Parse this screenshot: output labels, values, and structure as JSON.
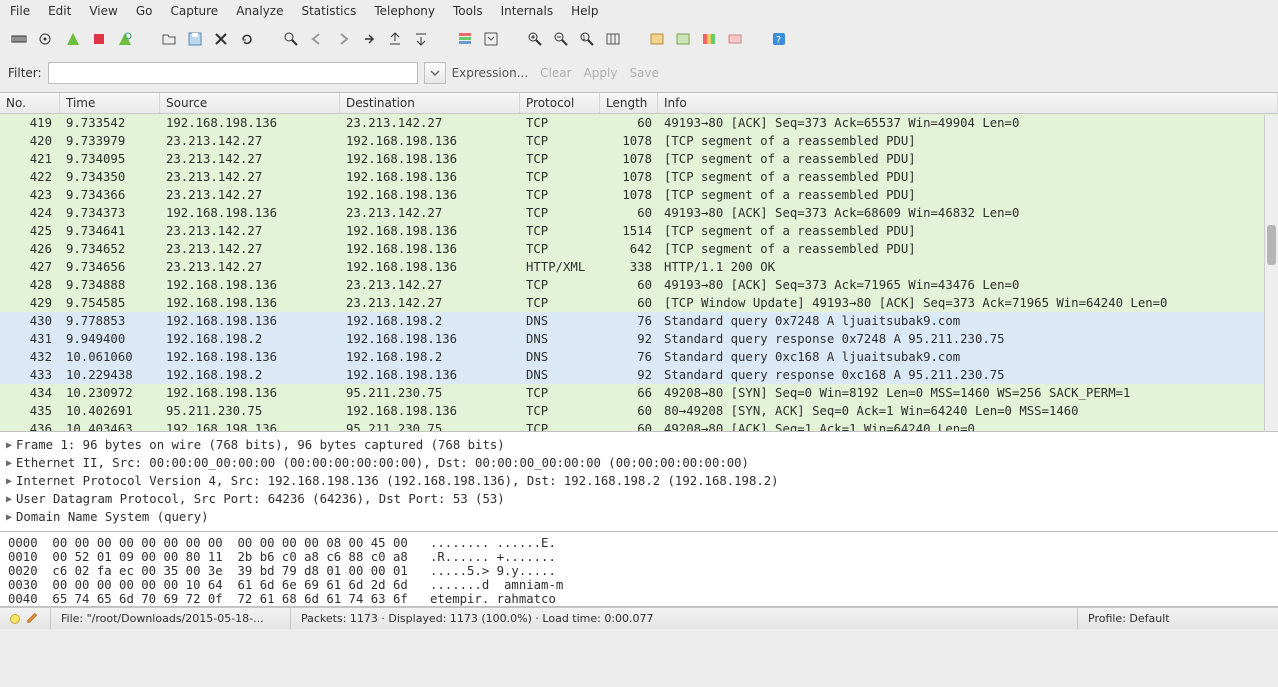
{
  "menu": [
    "File",
    "Edit",
    "View",
    "Go",
    "Capture",
    "Analyze",
    "Statistics",
    "Telephony",
    "Tools",
    "Internals",
    "Help"
  ],
  "filter": {
    "label": "Filter:",
    "value": "",
    "placeholder": "",
    "expression": "Expression...",
    "clear": "Clear",
    "apply": "Apply",
    "save": "Save"
  },
  "columns": [
    "No.",
    "Time",
    "Source",
    "Destination",
    "Protocol",
    "Length",
    "Info"
  ],
  "rows": [
    {
      "no": "419",
      "time": "9.733542",
      "src": "192.168.198.136",
      "dst": "23.213.142.27",
      "proto": "TCP",
      "len": "60",
      "info": "49193→80 [ACK] Seq=373 Ack=65537 Win=49904 Len=0",
      "cls": "c-green"
    },
    {
      "no": "420",
      "time": "9.733979",
      "src": "23.213.142.27",
      "dst": "192.168.198.136",
      "proto": "TCP",
      "len": "1078",
      "info": "[TCP segment of a reassembled PDU]",
      "cls": "c-green"
    },
    {
      "no": "421",
      "time": "9.734095",
      "src": "23.213.142.27",
      "dst": "192.168.198.136",
      "proto": "TCP",
      "len": "1078",
      "info": "[TCP segment of a reassembled PDU]",
      "cls": "c-green"
    },
    {
      "no": "422",
      "time": "9.734350",
      "src": "23.213.142.27",
      "dst": "192.168.198.136",
      "proto": "TCP",
      "len": "1078",
      "info": "[TCP segment of a reassembled PDU]",
      "cls": "c-green"
    },
    {
      "no": "423",
      "time": "9.734366",
      "src": "23.213.142.27",
      "dst": "192.168.198.136",
      "proto": "TCP",
      "len": "1078",
      "info": "[TCP segment of a reassembled PDU]",
      "cls": "c-green"
    },
    {
      "no": "424",
      "time": "9.734373",
      "src": "192.168.198.136",
      "dst": "23.213.142.27",
      "proto": "TCP",
      "len": "60",
      "info": "49193→80 [ACK] Seq=373 Ack=68609 Win=46832 Len=0",
      "cls": "c-green"
    },
    {
      "no": "425",
      "time": "9.734641",
      "src": "23.213.142.27",
      "dst": "192.168.198.136",
      "proto": "TCP",
      "len": "1514",
      "info": "[TCP segment of a reassembled PDU]",
      "cls": "c-green"
    },
    {
      "no": "426",
      "time": "9.734652",
      "src": "23.213.142.27",
      "dst": "192.168.198.136",
      "proto": "TCP",
      "len": "642",
      "info": "[TCP segment of a reassembled PDU]",
      "cls": "c-green"
    },
    {
      "no": "427",
      "time": "9.734656",
      "src": "23.213.142.27",
      "dst": "192.168.198.136",
      "proto": "HTTP/XML",
      "len": "338",
      "info": "HTTP/1.1 200 OK",
      "cls": "c-green"
    },
    {
      "no": "428",
      "time": "9.734888",
      "src": "192.168.198.136",
      "dst": "23.213.142.27",
      "proto": "TCP",
      "len": "60",
      "info": "49193→80 [ACK] Seq=373 Ack=71965 Win=43476 Len=0",
      "cls": "c-green"
    },
    {
      "no": "429",
      "time": "9.754585",
      "src": "192.168.198.136",
      "dst": "23.213.142.27",
      "proto": "TCP",
      "len": "60",
      "info": "[TCP Window Update] 49193→80 [ACK] Seq=373 Ack=71965 Win=64240 Len=0",
      "cls": "c-green"
    },
    {
      "no": "430",
      "time": "9.778853",
      "src": "192.168.198.136",
      "dst": "192.168.198.2",
      "proto": "DNS",
      "len": "76",
      "info": "Standard query 0x7248  A ljuaitsubak9.com",
      "cls": "c-blue"
    },
    {
      "no": "431",
      "time": "9.949400",
      "src": "192.168.198.2",
      "dst": "192.168.198.136",
      "proto": "DNS",
      "len": "92",
      "info": "Standard query response 0x7248  A 95.211.230.75",
      "cls": "c-blue"
    },
    {
      "no": "432",
      "time": "10.061060",
      "src": "192.168.198.136",
      "dst": "192.168.198.2",
      "proto": "DNS",
      "len": "76",
      "info": "Standard query 0xc168  A ljuaitsubak9.com",
      "cls": "c-blue"
    },
    {
      "no": "433",
      "time": "10.229438",
      "src": "192.168.198.2",
      "dst": "192.168.198.136",
      "proto": "DNS",
      "len": "92",
      "info": "Standard query response 0xc168  A 95.211.230.75",
      "cls": "c-blue"
    },
    {
      "no": "434",
      "time": "10.230972",
      "src": "192.168.198.136",
      "dst": "95.211.230.75",
      "proto": "TCP",
      "len": "66",
      "info": "49208→80 [SYN] Seq=0 Win=8192 Len=0 MSS=1460 WS=256 SACK_PERM=1",
      "cls": "c-green"
    },
    {
      "no": "435",
      "time": "10.402691",
      "src": "95.211.230.75",
      "dst": "192.168.198.136",
      "proto": "TCP",
      "len": "60",
      "info": "80→49208 [SYN, ACK] Seq=0 Ack=1 Win=64240 Len=0 MSS=1460",
      "cls": "c-green"
    },
    {
      "no": "436",
      "time": "10.403463",
      "src": "192.168.198.136",
      "dst": "95.211.230.75",
      "proto": "TCP",
      "len": "60",
      "info": "49208→80 [ACK] Seq=1 Ack=1 Win=64240 Len=0",
      "cls": "c-green"
    }
  ],
  "details": [
    "Frame 1: 96 bytes on wire (768 bits), 96 bytes captured (768 bits)",
    "Ethernet II, Src: 00:00:00_00:00:00 (00:00:00:00:00:00), Dst: 00:00:00_00:00:00 (00:00:00:00:00:00)",
    "Internet Protocol Version 4, Src: 192.168.198.136 (192.168.198.136), Dst: 192.168.198.2 (192.168.198.2)",
    "User Datagram Protocol, Src Port: 64236 (64236), Dst Port: 53 (53)",
    "Domain Name System (query)"
  ],
  "hex": "0000  00 00 00 00 00 00 00 00  00 00 00 00 08 00 45 00   ........ ......E.\n0010  00 52 01 09 00 00 80 11  2b b6 c0 a8 c6 88 c0 a8   .R...... +.......\n0020  c6 02 fa ec 00 35 00 3e  39 bd 79 d8 01 00 00 01   .....5.> 9.y.....\n0030  00 00 00 00 00 00 10 64  61 6d 6e 69 61 6d 2d 6d   .......d  amniam-m\n0040  65 74 65 6d 70 69 72 0f  72 61 68 6d 61 74 63 6f   etempir. rahmatco",
  "status": {
    "file": "File: \"/root/Downloads/2015-05-18-...",
    "packets": "Packets: 1173 · Displayed: 1173 (100.0%) · Load time: 0:00.077",
    "profile": "Profile: Default"
  },
  "colors": {
    "green_dot": "#f7e463",
    "pencil": "#d97b00"
  }
}
